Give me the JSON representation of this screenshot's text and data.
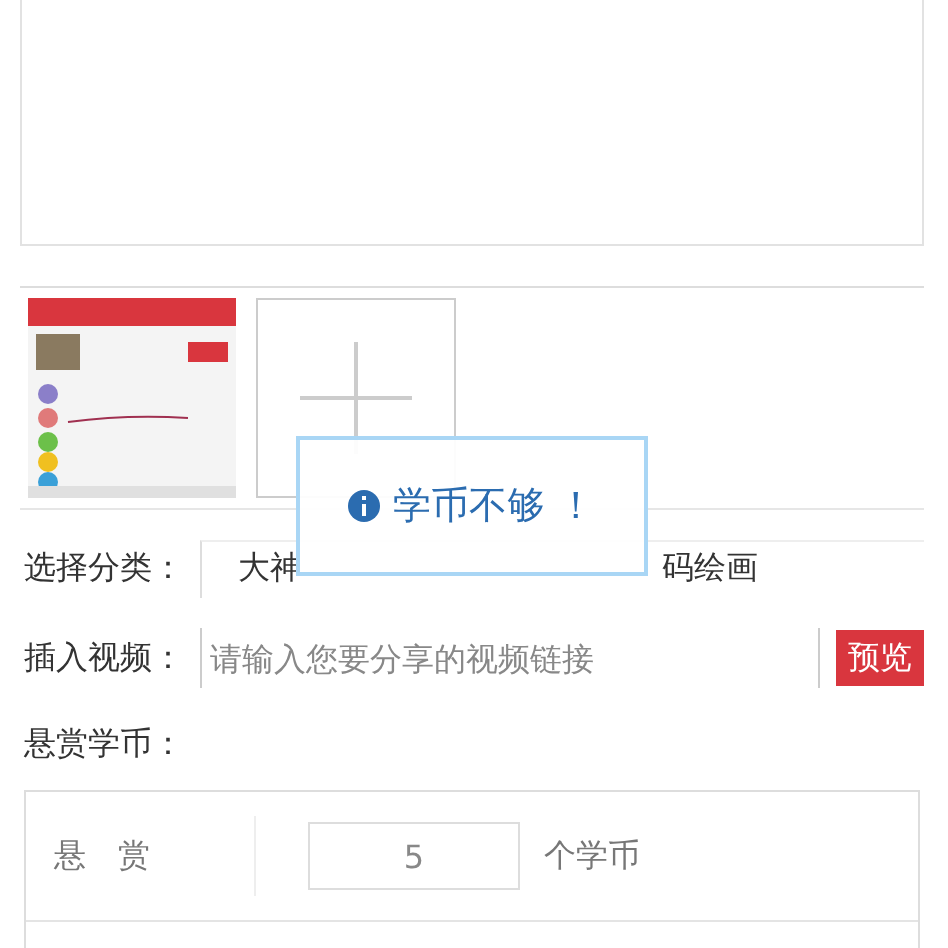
{
  "category": {
    "label": "选择分类：",
    "options": [
      {
        "label": "大神",
        "selected": false
      },
      {
        "label": "码绘画",
        "selected": false
      }
    ]
  },
  "video": {
    "label": "插入视频：",
    "placeholder": "请输入您要分享的视频链接",
    "button": "预览"
  },
  "reward": {
    "label": "悬赏学币：",
    "row_label": "悬　赏",
    "value": "5",
    "unit": "个学币"
  },
  "toast": {
    "message": "学币不够 ！"
  }
}
